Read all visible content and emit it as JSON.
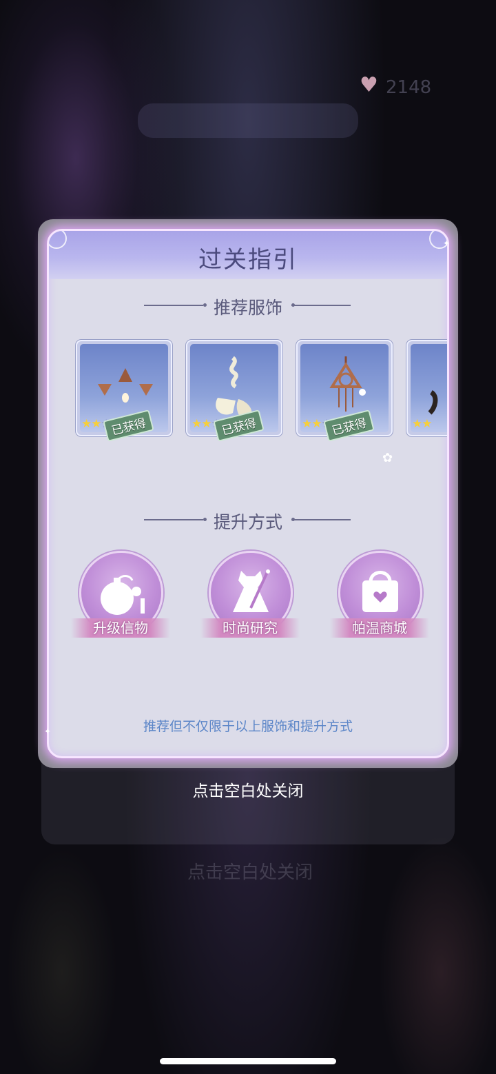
{
  "dialog": {
    "title": "过关指引",
    "sections": {
      "outfits_title": "推荐服饰",
      "methods_title": "提升方式"
    },
    "items": [
      {
        "badge": "已获得",
        "stars_total": 5,
        "stars_filled": 2
      },
      {
        "badge": "已获得",
        "stars_total": 5,
        "stars_filled": 2
      },
      {
        "badge": "已获得",
        "stars_total": 5,
        "stars_filled": 2
      },
      {
        "badge": "",
        "stars_total": 5,
        "stars_filled": 2
      }
    ],
    "methods": [
      {
        "label": "升级信物",
        "icon": "perfume-bottle-icon"
      },
      {
        "label": "时尚研究",
        "icon": "dress-sewing-icon"
      },
      {
        "label": "帕温商城",
        "icon": "shopping-bag-icon"
      }
    ],
    "note": "推荐但不仅限于以上服饰和提升方式"
  },
  "close_hint": "点击空白处关闭",
  "background": {
    "currency_text": "2148"
  },
  "colors": {
    "title": "#4b4a7d",
    "note": "#5c86c8",
    "badge": "#5f8c6e",
    "glow": "#e6aaff"
  }
}
